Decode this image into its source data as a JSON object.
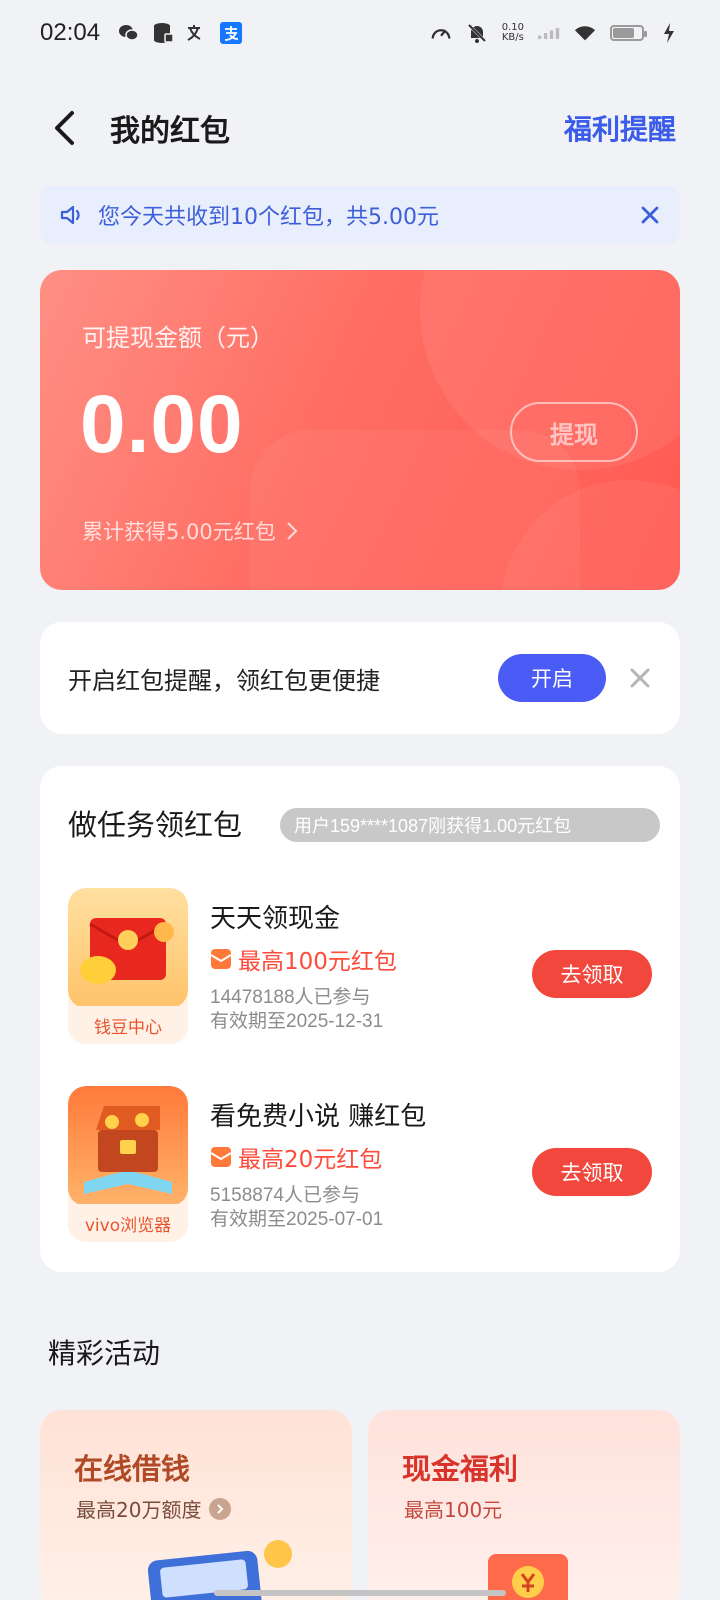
{
  "status_bar": {
    "time": "02:04",
    "net_speed_value": "0.10",
    "net_speed_unit": "KB/s",
    "icons": [
      "wechat-icon",
      "database-icon",
      "translate-icon",
      "alipay-icon",
      "speedometer-icon",
      "mute-bell-icon",
      "signal-icon",
      "wifi-icon",
      "battery-icon",
      "charging-icon"
    ]
  },
  "header": {
    "title": "我的红包",
    "right_link": "福利提醒"
  },
  "notice": {
    "text": "您今天共收到10个红包，共5.00元"
  },
  "balance": {
    "label": "可提现金额（元）",
    "amount": "0.00",
    "withdraw_label": "提现",
    "total_text": "累计获得5.00元红包"
  },
  "reminder": {
    "text": "开启红包提醒，领红包更便捷",
    "button": "开启"
  },
  "tasks": {
    "title": "做任务领红包",
    "ticker": "用户159****1087刚获得1.00元红包",
    "items": [
      {
        "app_label": "钱豆中心",
        "name": "天天领现金",
        "reward": "最高100元红包",
        "participants": "14478188人已参与",
        "expiry": "有效期至2025-12-31",
        "button": "去领取"
      },
      {
        "app_label": "vivo浏览器",
        "name": "看免费小说 赚红包",
        "reward": "最高20元红包",
        "participants": "5158874人已参与",
        "expiry": "有效期至2025-07-01",
        "button": "去领取"
      }
    ]
  },
  "activities": {
    "title": "精彩活动",
    "cards": [
      {
        "title": "在线借钱",
        "subtitle": "最高20万额度"
      },
      {
        "title": "现金福利",
        "subtitle": "最高100元"
      }
    ]
  },
  "colors": {
    "accent_blue": "#3b5ce8",
    "button_blue": "#4a5cf5",
    "red": "#f2473c",
    "card_red": "#ff6d63"
  }
}
